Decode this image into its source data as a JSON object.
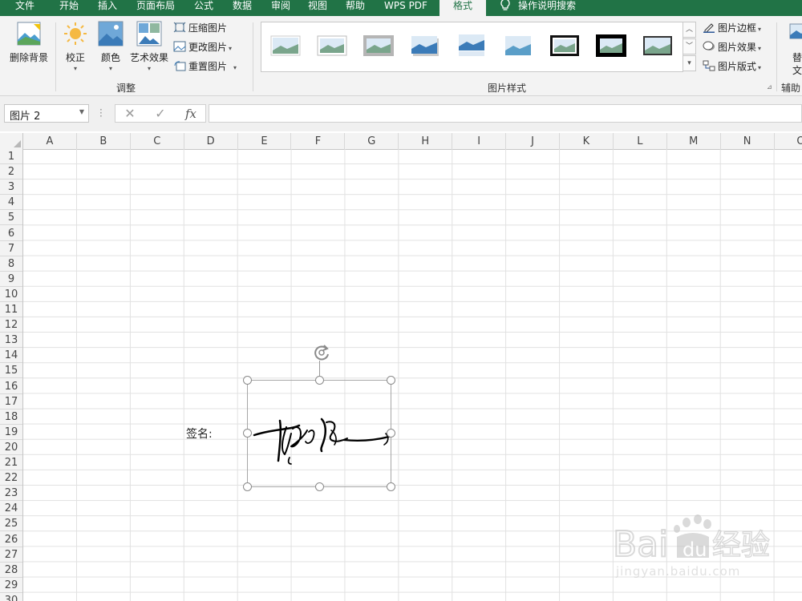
{
  "menu": {
    "tabs": [
      {
        "label": "文件"
      },
      {
        "label": "开始"
      },
      {
        "label": "插入"
      },
      {
        "label": "页面布局"
      },
      {
        "label": "公式"
      },
      {
        "label": "数据"
      },
      {
        "label": "审阅"
      },
      {
        "label": "视图"
      },
      {
        "label": "帮助"
      },
      {
        "label": "WPS PDF"
      },
      {
        "label": "格式",
        "active": true
      }
    ],
    "tell_me": "操作说明搜索"
  },
  "ribbon": {
    "remove_background": "删除背景",
    "corrections": "校正",
    "color": "颜色",
    "artistic_effects": "艺术效果",
    "compress": "压缩图片",
    "change_picture": "更改图片",
    "reset_picture": "重置图片",
    "adjust_group": "调整",
    "picture_styles_group": "图片样式",
    "picture_border": "图片边框",
    "picture_effects": "图片效果",
    "picture_layout": "图片版式",
    "alt_text_partial_1": "替",
    "alt_text_partial_2": "文",
    "accessibility_group": "辅助"
  },
  "formula_bar": {
    "name_box": "图片 2",
    "cancel": "✕",
    "enter": "✓",
    "fx": "fx",
    "value": ""
  },
  "sheet": {
    "columns": [
      "A",
      "B",
      "C",
      "D",
      "E",
      "F",
      "G",
      "H",
      "I",
      "J",
      "K",
      "L",
      "M",
      "N",
      "O"
    ],
    "rows": [
      "1",
      "2",
      "3",
      "4",
      "5",
      "6",
      "7",
      "8",
      "9",
      "10",
      "11",
      "12",
      "13",
      "14",
      "15",
      "16",
      "17",
      "18",
      "19",
      "20",
      "21",
      "22",
      "23",
      "24",
      "25",
      "26",
      "27",
      "28",
      "29",
      "30"
    ],
    "cell_D19": "签名:"
  },
  "picture": {
    "description": "handwritten signature image"
  },
  "watermark": {
    "logo_text": "Bai经验",
    "url": "jingyan.baidu.com"
  },
  "colors": {
    "excel_green": "#217346",
    "ribbon_bg": "#f3f3f3",
    "gridline": "#e1e1e1"
  }
}
